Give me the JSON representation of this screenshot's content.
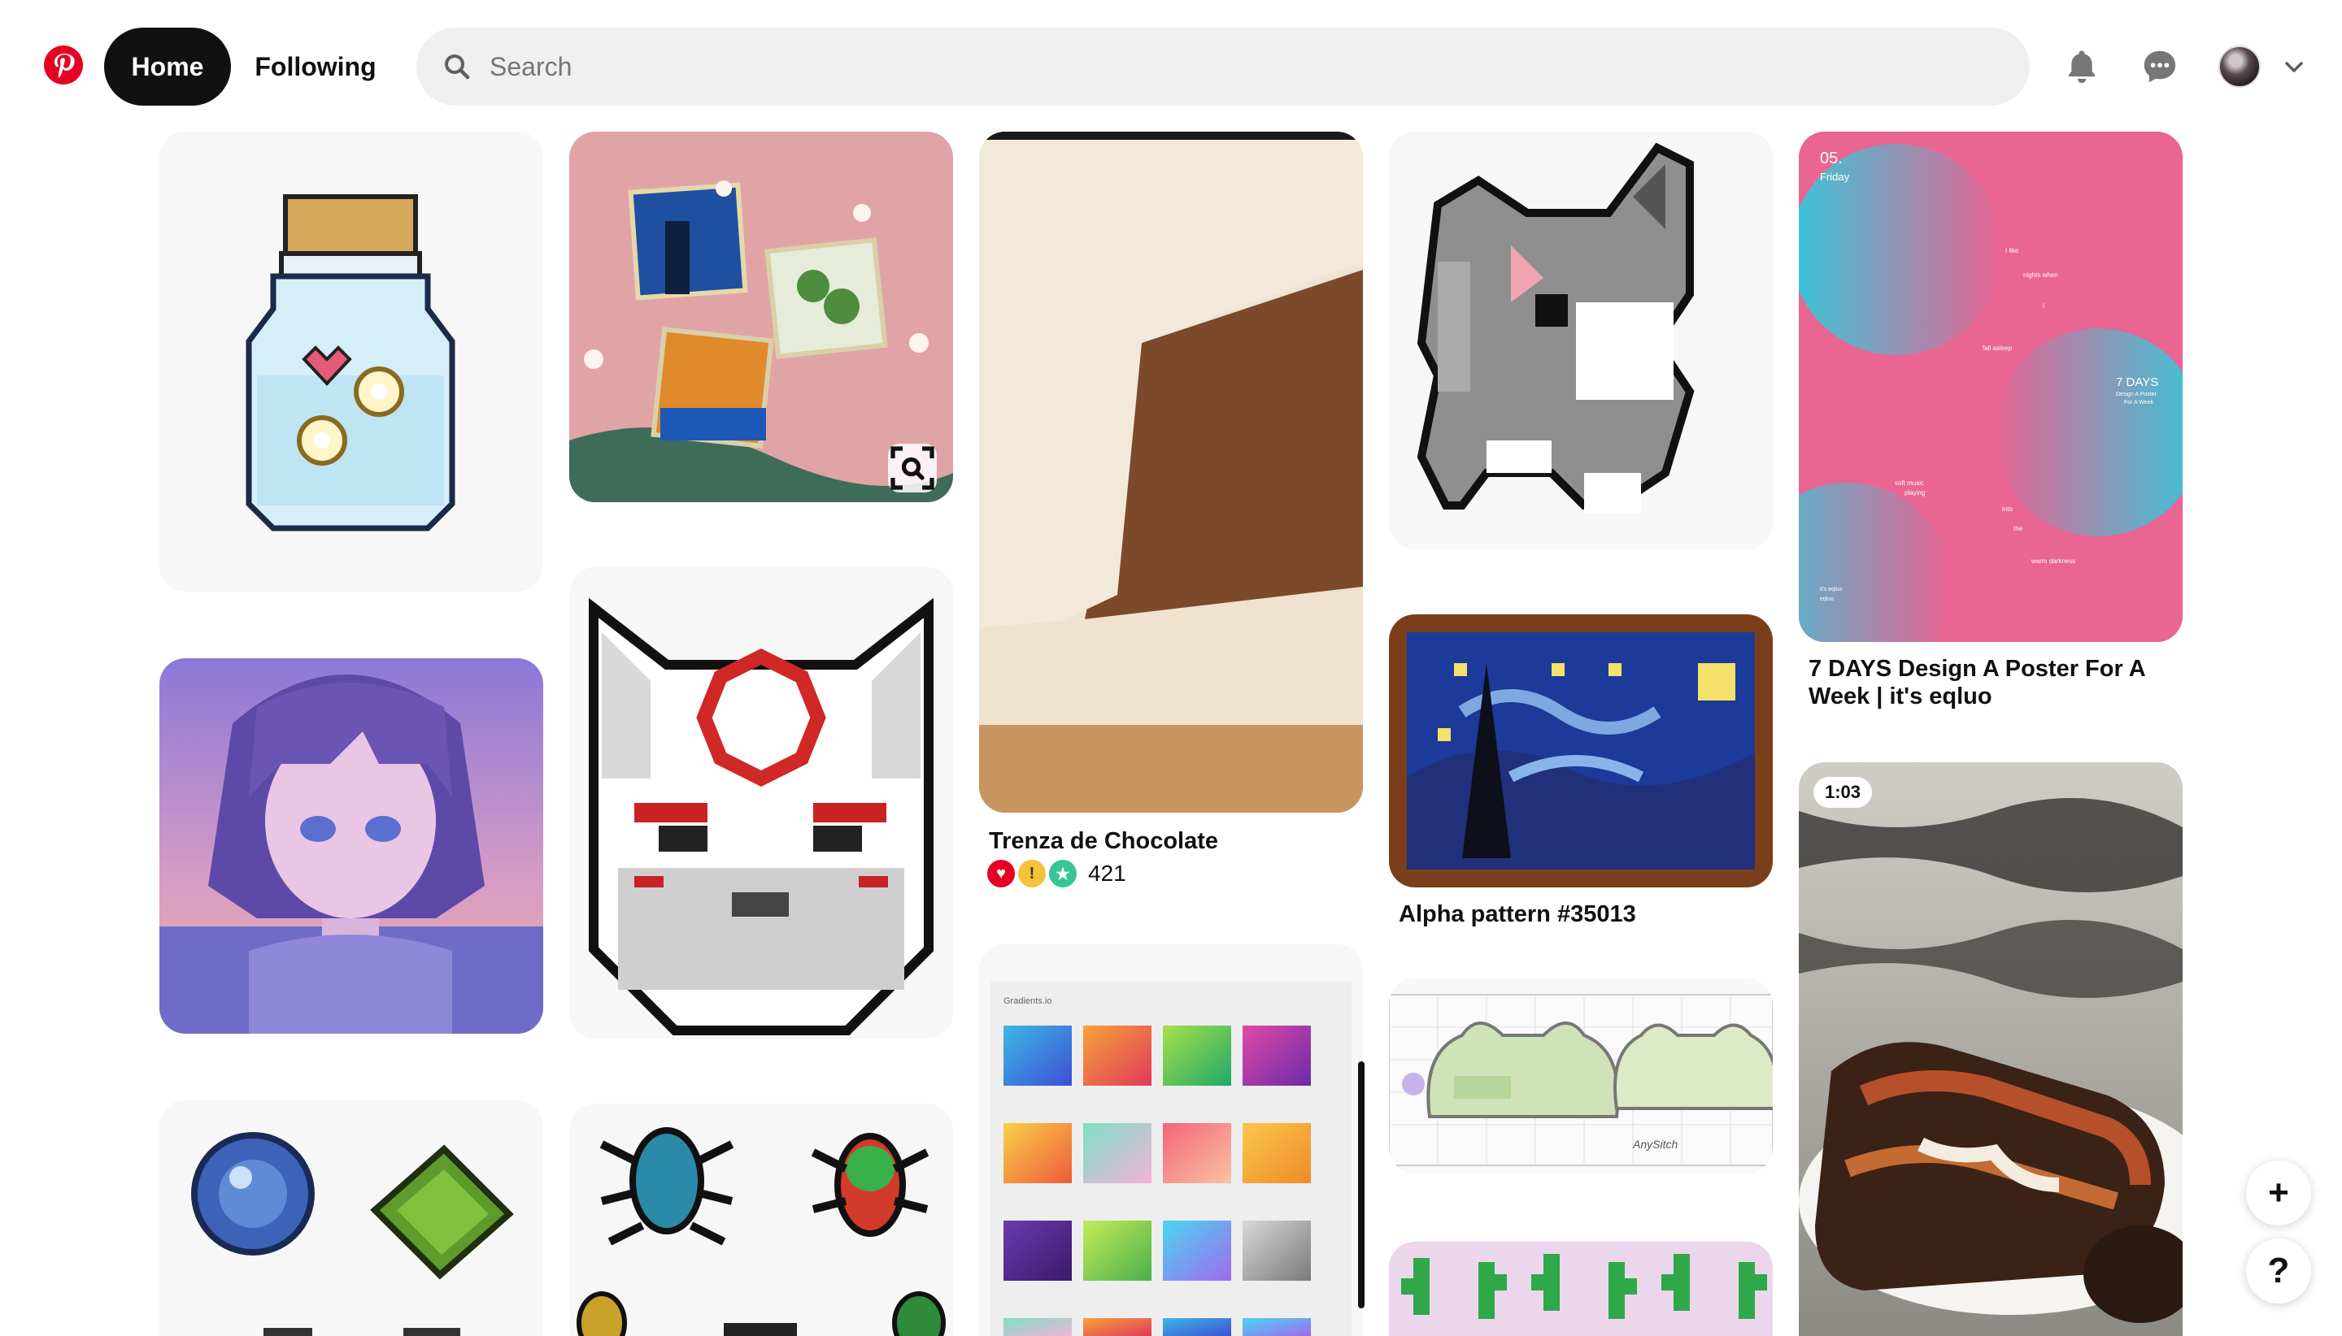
{
  "header": {
    "logo": "pinterest-logo",
    "nav": {
      "home": "Home",
      "following": "Following"
    },
    "search": {
      "placeholder": "Search",
      "value": ""
    },
    "icons": [
      "bell-icon",
      "messages-icon",
      "avatar",
      "chevron-down-icon"
    ]
  },
  "pins": {
    "trenza": {
      "caption": "Trenza de Chocolate",
      "reaction_count": "421"
    },
    "alpha": {
      "caption": "Alpha pattern #35013"
    },
    "poster": {
      "caption": "7 DAYS Design A Poster For A Week | it's eqluo",
      "image_text": {
        "date": "05.",
        "day": "Friday",
        "title": "7 DAYS",
        "sub1": "Design A Poster",
        "sub2": "For A Week",
        "l1": "I like",
        "l2": "nights when",
        "l3": "I",
        "l4": "fall asleep",
        "l5": "soft music",
        "l6": "playing",
        "l7": "into",
        "l8": "the",
        "l9": "warm darkness",
        "l10": "it's eqluo",
        "l11": "eqluo"
      }
    },
    "video": {
      "duration": "1:03"
    },
    "gradients": {
      "title": "Gradients.io"
    },
    "cross_stitch": {
      "signature": "AnySitch"
    }
  },
  "fab": {
    "add": "+",
    "help": "?"
  },
  "colors": {
    "brand": "#e60023",
    "active_nav": "#111111",
    "search_bg": "#efefef",
    "poster_bg": "#e96592"
  }
}
